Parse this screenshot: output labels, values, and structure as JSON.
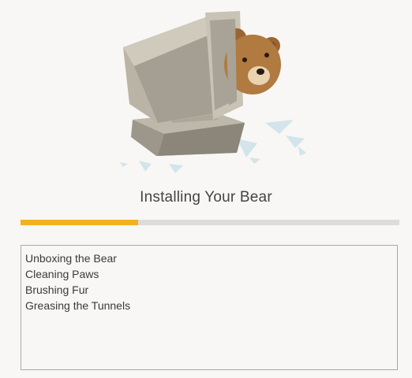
{
  "title": "Installing Your Bear",
  "progress": {
    "fraction": 0.31,
    "color": "#f0b21f",
    "track_color": "#dcdcdc"
  },
  "log": {
    "lines": [
      "Unboxing the Bear",
      "Cleaning Paws",
      "Brushing Fur",
      "Greasing the Tunnels"
    ]
  },
  "illustration": {
    "icon": "bear-in-computer-illustration"
  }
}
